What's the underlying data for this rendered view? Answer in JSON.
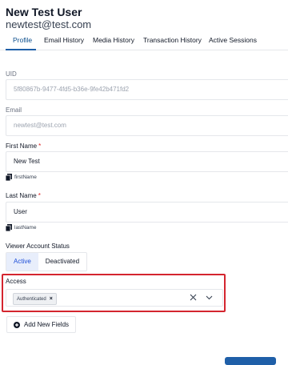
{
  "header": {
    "title": "New Test User",
    "email": "newtest@test.com"
  },
  "tabs": [
    {
      "label": "Profile"
    },
    {
      "label": "Email History"
    },
    {
      "label": "Media History"
    },
    {
      "label": "Transaction History"
    },
    {
      "label": "Active Sessions"
    }
  ],
  "fields": {
    "uid": {
      "label": "UID",
      "value": "5f80867b-9477-4fd5-b36e-9fe42b471fd2"
    },
    "email": {
      "label": "Email",
      "value": "newtest@test.com"
    },
    "first_name": {
      "label": "First Name",
      "required": "*",
      "value": "New Test",
      "hint": "firstName"
    },
    "last_name": {
      "label": "Last Name",
      "required": "*",
      "value": "User",
      "hint": "lastName"
    }
  },
  "status": {
    "label": "Viewer Account Status",
    "options": [
      "Active",
      "Deactivated"
    ],
    "selected": "Active"
  },
  "access": {
    "label": "Access",
    "tags": [
      "Authenticated"
    ],
    "tag_remove": "×"
  },
  "actions": {
    "add_fields": "Add New Fields"
  },
  "colors": {
    "accent": "#1f5fa8",
    "highlight": "#d4252f",
    "required": "#dc2626"
  }
}
